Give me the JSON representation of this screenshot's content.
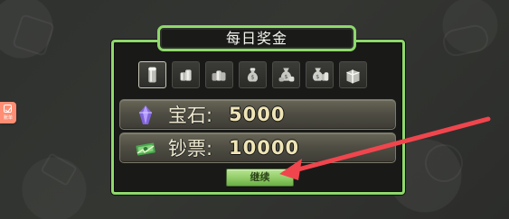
{
  "dialog": {
    "title": "每日奖金",
    "days": [
      {
        "icon": "single-coin-icon",
        "active": true
      },
      {
        "icon": "coin-stack-icon",
        "active": false
      },
      {
        "icon": "coin-stack-large-icon",
        "active": false
      },
      {
        "icon": "money-bag-icon",
        "active": false
      },
      {
        "icon": "money-bag-coins-icon",
        "active": false
      },
      {
        "icon": "money-bag-stack-icon",
        "active": false
      },
      {
        "icon": "treasure-box-icon",
        "active": false
      }
    ],
    "rewards": [
      {
        "label": "宝石:",
        "value": "5000",
        "icon": "gem-icon"
      },
      {
        "label": "钞票:",
        "value": "10000",
        "icon": "cash-icon"
      }
    ],
    "continue_label": "继续"
  },
  "side_badge": {
    "text": "账单",
    "color": "#ff8e74"
  },
  "colors": {
    "panel_border": "#8ed86b",
    "annotation_arrow": "#f0454d"
  }
}
